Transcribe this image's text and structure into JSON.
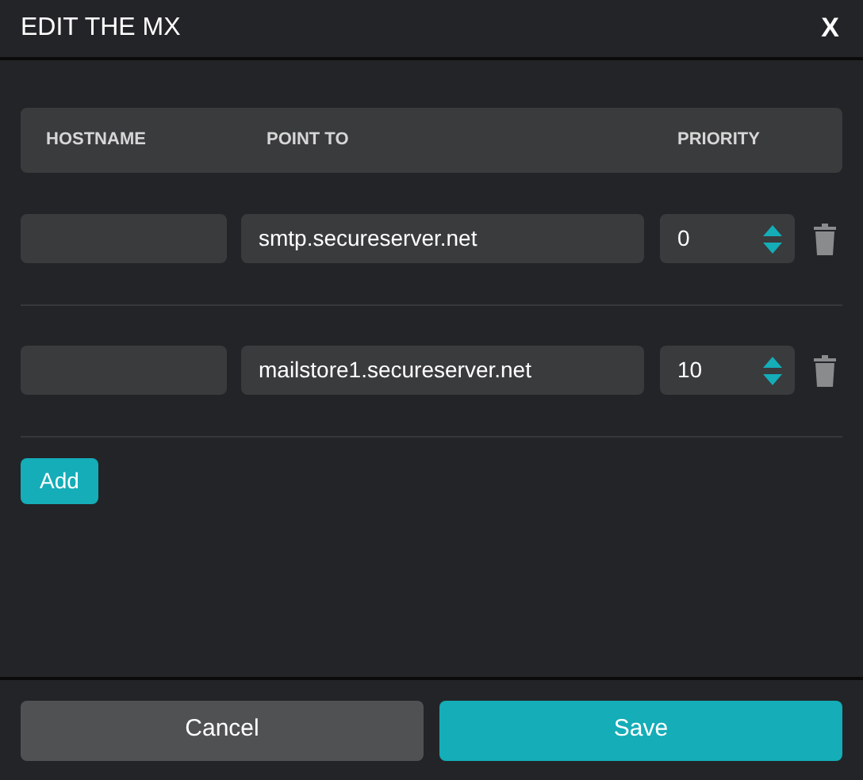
{
  "dialog": {
    "title": "EDIT THE MX",
    "close": "X"
  },
  "table": {
    "columns": [
      "HOSTNAME",
      "POINT TO",
      "PRIORITY"
    ],
    "rows": [
      {
        "hostname": "",
        "point_to": "smtp.secureserver.net",
        "priority": "0"
      },
      {
        "hostname": "",
        "point_to": "mailstore1.secureserver.net",
        "priority": "10"
      }
    ]
  },
  "add_button": "Add",
  "buttons": [
    "Cancel",
    "Save"
  ]
}
